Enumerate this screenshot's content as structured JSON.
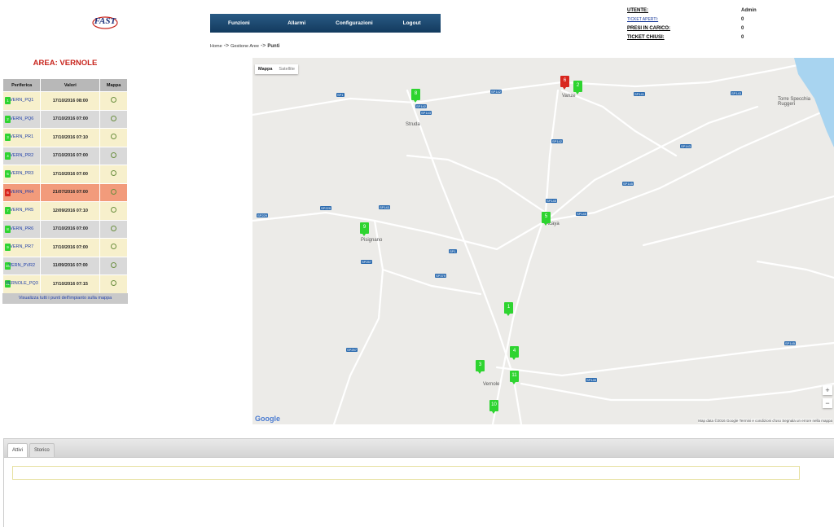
{
  "logo": {
    "text": "FAST"
  },
  "nav": {
    "items": [
      "Funzioni",
      "Allarmi",
      "Configurazioni",
      "Logout"
    ]
  },
  "breadcrumb": {
    "home": "Home",
    "sep": "->",
    "mid": "Gestione Aree",
    "current": "Punti"
  },
  "user": {
    "utente_label": "UTENTE:",
    "utente_value": "Admin",
    "ticket_aperti_label": "TICKET APERTI:",
    "ticket_aperti_value": "0",
    "presi_label": "PRESI IN CARICO:",
    "presi_value": "0",
    "chiusi_label": "TICKET CHIUSI:",
    "chiusi_value": "0"
  },
  "area_title": "AREA: VERNOLE",
  "table": {
    "headers": [
      "Periferica",
      "Valori",
      "Mappa"
    ],
    "rows": [
      {
        "pin": "1",
        "name": "VERN_PQ1",
        "value": "17/10/2016 08:00",
        "status": "ok"
      },
      {
        "pin": "2",
        "name": "VERN_PQ6",
        "value": "17/10/2016 07:00",
        "status": "ok"
      },
      {
        "pin": "3",
        "name": "VERN_PR1",
        "value": "17/10/2016 07:10",
        "status": "ok"
      },
      {
        "pin": "4",
        "name": "VERN_PR2",
        "value": "17/10/2016 07:00",
        "status": "ok"
      },
      {
        "pin": "5",
        "name": "VERN_PR3",
        "value": "17/10/2016 07:00",
        "status": "ok"
      },
      {
        "pin": "6",
        "name": "VERN_PR4",
        "value": "21/07/2016 07:00",
        "status": "alarm"
      },
      {
        "pin": "7",
        "name": "VERN_PR5",
        "value": "12/09/2016 07:10",
        "status": "ok"
      },
      {
        "pin": "8",
        "name": "VERN_PR6",
        "value": "17/10/2016 07:00",
        "status": "ok"
      },
      {
        "pin": "9",
        "name": "VERN_PR7",
        "value": "17/10/2016 07:00",
        "status": "ok"
      },
      {
        "pin": "10",
        "name": "VERN_PVR2",
        "value": "11/09/2016 07:00",
        "status": "ok"
      },
      {
        "pin": "11",
        "name": "VERNOLE_PQ3",
        "value": "17/10/2016 07:15",
        "status": "ok"
      }
    ],
    "view_all": "Visualizza tutti i punti dell'impianto sulla mappa"
  },
  "map": {
    "type_map": "Mappa",
    "type_sat": "Satellite",
    "places": [
      "Struda",
      "Vanze",
      "Acaya",
      "Pisignano",
      "Vernole",
      "Torre Specchia Ruggeri"
    ],
    "markers": [
      "8",
      "6",
      "2",
      "5",
      "9",
      "1",
      "3",
      "4",
      "11",
      "10"
    ],
    "roads": [
      "SP1",
      "SP142",
      "SP142",
      "SP143",
      "SP141",
      "SP143",
      "SP142",
      "SP143",
      "SP145",
      "SP229",
      "SP229",
      "SP143",
      "SP145",
      "SP257",
      "SP1",
      "SP379",
      "SP145",
      "SP145",
      "SP257",
      "SP145"
    ],
    "zoom_in": "+",
    "zoom_out": "−",
    "google": "Google",
    "attribution": "Map data ©2016 Google   Termini e condizioni d'uso   Segnala un errore nella mappa"
  },
  "panel": {
    "tabs": [
      "Attivi",
      "Storico"
    ]
  }
}
